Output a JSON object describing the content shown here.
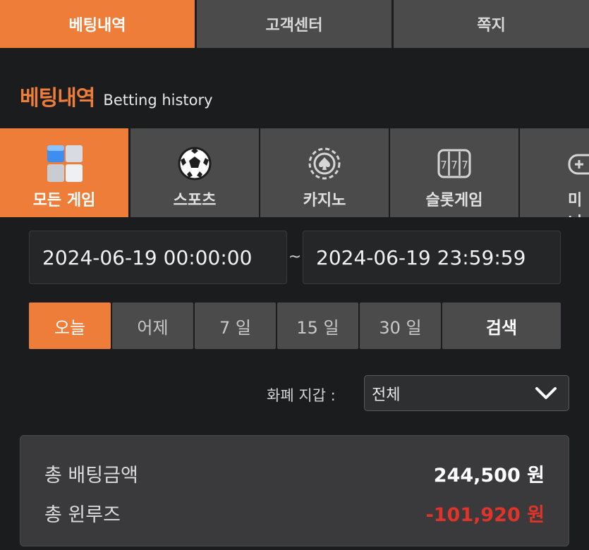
{
  "top_tabs": [
    {
      "label": "베팅내역",
      "active": true
    },
    {
      "label": "고객센터",
      "active": false
    },
    {
      "label": "쪽지",
      "active": false
    }
  ],
  "heading": {
    "title": "베팅내역",
    "subtitle": "Betting history"
  },
  "game_tabs": [
    {
      "label": "모든 게임",
      "icon": "all-games-cubes-icon",
      "active": true
    },
    {
      "label": "스포츠",
      "icon": "soccer-ball-icon",
      "active": false
    },
    {
      "label": "카지노",
      "icon": "casino-chip-spade-icon",
      "active": false
    },
    {
      "label": "슬롯게임",
      "icon": "slot-777-icon",
      "active": false
    },
    {
      "label": "미니",
      "icon": "gamepad-icon",
      "active": false
    }
  ],
  "date_range": {
    "from": "2024-06-19 00:00:00",
    "separator": "~",
    "to": "2024-06-19 23:59:59"
  },
  "quick_ranges": [
    {
      "label": "오늘",
      "active": true
    },
    {
      "label": "어제",
      "active": false
    },
    {
      "label": "7 일",
      "active": false
    },
    {
      "label": "15 일",
      "active": false
    },
    {
      "label": "30 일",
      "active": false
    }
  ],
  "search_label": "검색",
  "currency_filter": {
    "label": "화폐 지갑 :",
    "selected": "전체"
  },
  "summary": {
    "total_bet_label": "총 배팅금액",
    "total_bet_value": "244,500 원",
    "total_winloss_label": "총 윈루즈",
    "total_winloss_value": "-101,920 원"
  },
  "colors": {
    "accent": "#ed7d38",
    "negative": "#e0332a",
    "background": "#1b1c1e",
    "tab_bg": "#4b4b4c"
  }
}
